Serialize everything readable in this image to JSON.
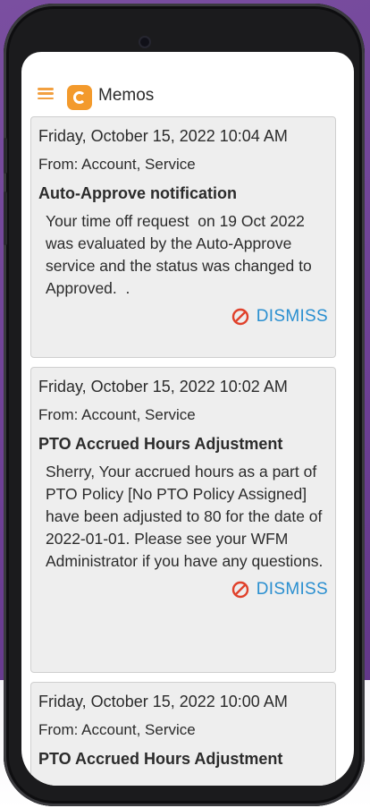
{
  "app": {
    "title": "Memos"
  },
  "memos": [
    {
      "date": "Friday, October 15, 2022 10:04 AM",
      "from": "From: Account, Service",
      "subject": "Auto-Approve notification",
      "body": "Your time off request  on 19 Oct 2022 was evaluated by the Auto-Approve service and the status was changed to Approved.  .",
      "dismiss_label": "DISMISS"
    },
    {
      "date": "Friday, October 15, 2022 10:02 AM",
      "from": "From: Account, Service",
      "subject": "PTO Accrued Hours Adjustment",
      "body": "Sherry, Your accrued hours as a part of PTO Policy [No PTO Policy Assigned] have been adjusted to 80 for the date of 2022-01-01. Please see your WFM Administrator if you have any questions.",
      "dismiss_label": "DISMISS"
    },
    {
      "date": "Friday, October 15, 2022 10:00 AM",
      "from": "From: Account, Service",
      "subject": "PTO Accrued Hours Adjustment"
    }
  ],
  "colors": {
    "accent": "#f39a2c",
    "dismiss": "#2a8fd0",
    "dismiss_icon": "#e0412b",
    "background": "#6d3f95"
  },
  "icons": {
    "menu": "hamburger-icon",
    "logo": "c-logo-icon",
    "dismiss": "no-entry-icon"
  }
}
